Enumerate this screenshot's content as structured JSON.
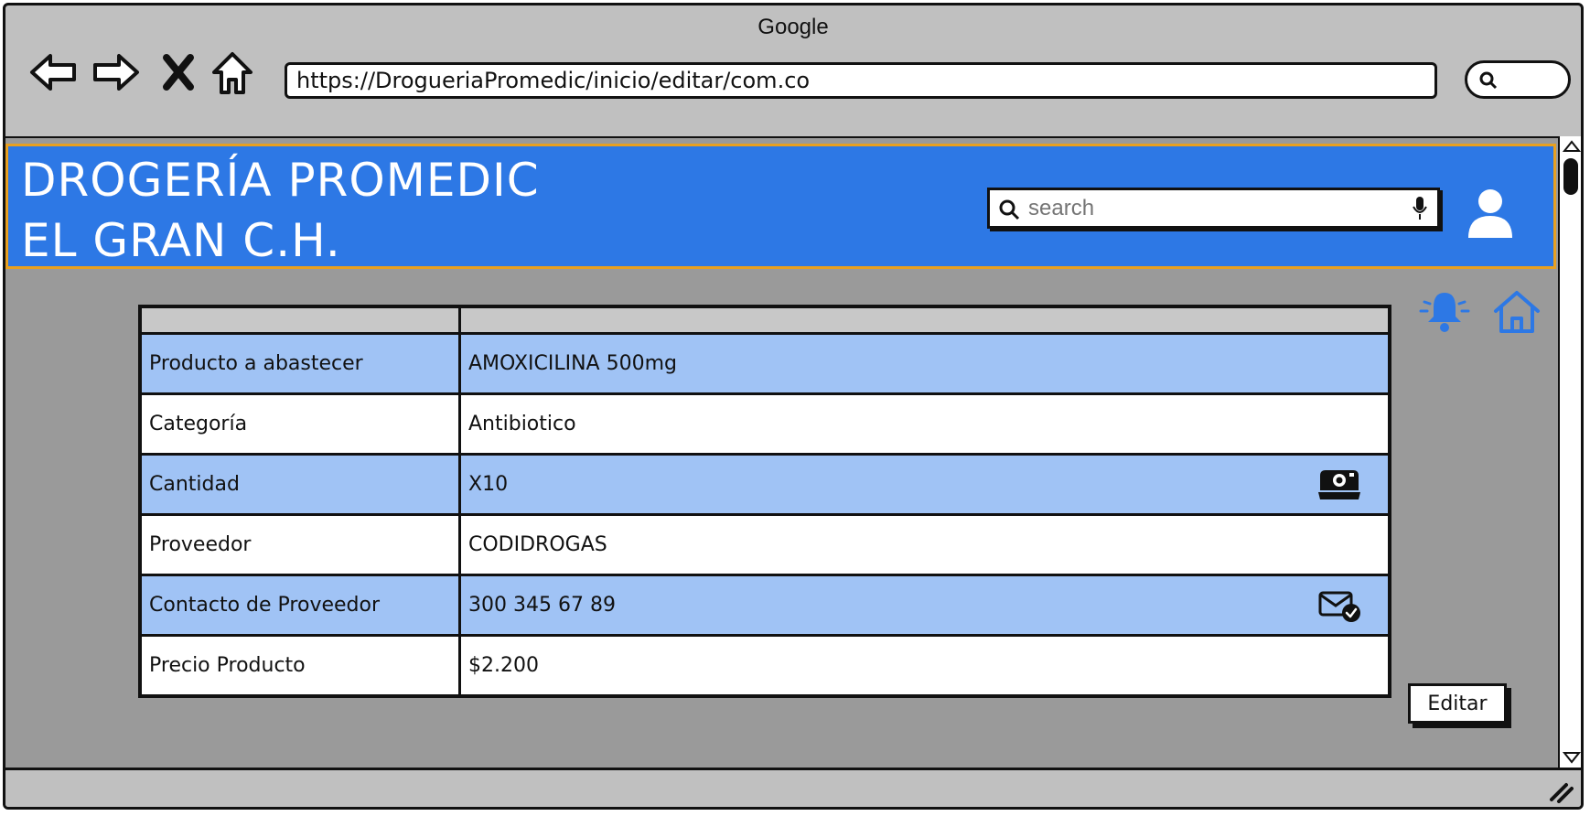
{
  "browser": {
    "title": "Google",
    "url": "https://DrogueriaPromedic/inicio/editar/com.co"
  },
  "header": {
    "brand_line1": "DROGERÍA PROMEDIC",
    "brand_line2": "EL GRAN C.H.",
    "search_placeholder": "search"
  },
  "table": {
    "rows": [
      {
        "label": "Producto a abastecer",
        "value": "AMOXICILINA 500mg",
        "icon": ""
      },
      {
        "label": "Categoría",
        "value": "Antibiotico",
        "icon": ""
      },
      {
        "label": "Cantidad",
        "value": "X10",
        "icon": "camera-icon"
      },
      {
        "label": "Proveedor",
        "value": "CODIDROGAS",
        "icon": ""
      },
      {
        "label": "Contacto de Proveedor",
        "value": "300 345 67 89",
        "icon": "mail-check-icon"
      },
      {
        "label": "Precio Producto",
        "value": "$2.200",
        "icon": ""
      }
    ]
  },
  "actions": {
    "edit_label": "Editar"
  },
  "colors": {
    "header_blue": "#2d78e5",
    "header_border": "#e8a020",
    "row_highlight": "#a0c3f5",
    "viewport_gray": "#9a9a9a"
  }
}
